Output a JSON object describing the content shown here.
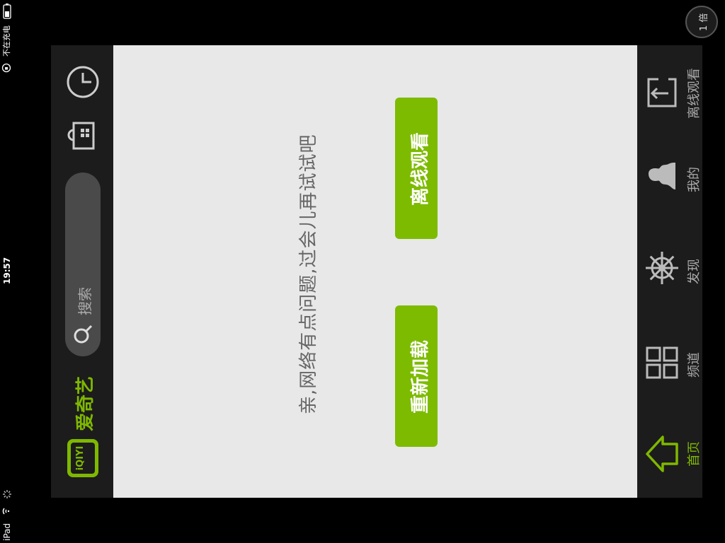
{
  "status_bar": {
    "device": "iPad",
    "time": "19:57",
    "battery_text": "不在充电"
  },
  "header": {
    "speed_badge": "1 倍"
  },
  "sidebar": {
    "logo_text": "爱奇艺",
    "logo_mark": "iQIYI",
    "search_placeholder": "搜索"
  },
  "main": {
    "error_message": "亲,网络有点问题,过会儿再试试吧",
    "offline_button": "离线观看",
    "reload_button": "重新加载"
  },
  "nav": {
    "items": [
      {
        "label": "离线观看",
        "icon": "download-box-icon"
      },
      {
        "label": "我的",
        "icon": "person-icon"
      },
      {
        "label": "发现",
        "icon": "ship-wheel-icon"
      },
      {
        "label": "频道",
        "icon": "grid-icon"
      },
      {
        "label": "首页",
        "icon": "home-icon",
        "active": true
      }
    ]
  },
  "colors": {
    "accent": "#7dbb00",
    "content_bg": "#e8e8e8",
    "sidebar_bg": "#1c1c1c"
  }
}
